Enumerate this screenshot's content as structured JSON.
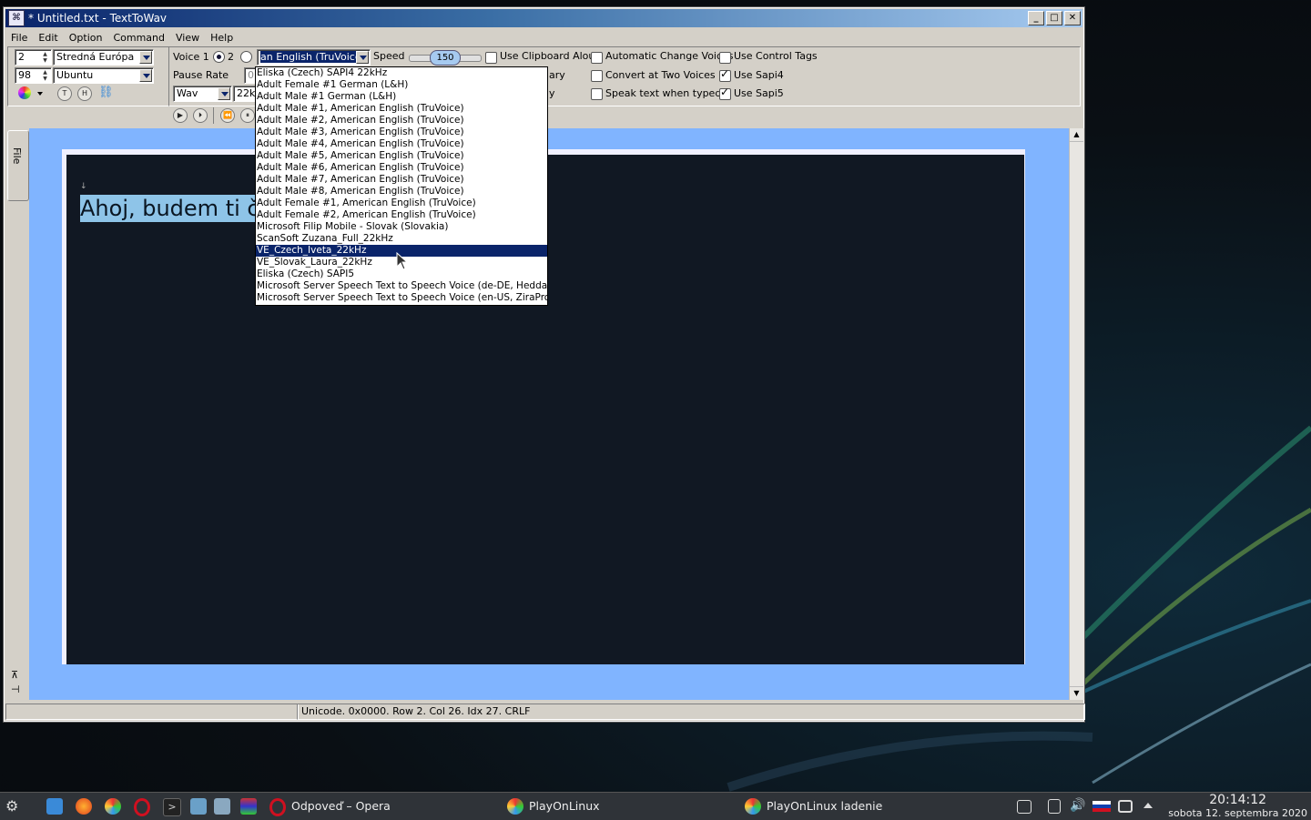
{
  "window": {
    "title": "* Untitled.txt - TextToWav",
    "btn_min": "_",
    "btn_max": "□",
    "btn_close": "✕"
  },
  "menu": [
    "File",
    "Edit",
    "Option",
    "Command",
    "View",
    "Help"
  ],
  "toolbar": {
    "font_size": "2",
    "charset": "Stredná Európa",
    "zoom": "98",
    "font_name": "Ubuntu",
    "voice_label": "Voice 1",
    "voice2_label": "2",
    "voice_selected": "an English (TruVoice)",
    "speed_label": "Speed",
    "speed_value": "150",
    "pause_rate_label": "Pause Rate",
    "pause_rate_value": "0",
    "format_value": "Wav",
    "rate_value": "22k",
    "partial_text_1": "ary",
    "partial_text_2": "y",
    "t_button": "T",
    "h_button": "H"
  },
  "checkboxes": [
    {
      "label": "Use Clipboard Aloud",
      "checked": false
    },
    {
      "label": "Automatic Change Voices",
      "checked": false
    },
    {
      "label": "Use Control Tags",
      "checked": false
    },
    {
      "label": "Convert at Two Voices",
      "checked": false
    },
    {
      "label": "Use Sapi4",
      "checked": true
    },
    {
      "label": "Speak text when typed",
      "checked": false
    },
    {
      "label": "Use Sapi5",
      "checked": true
    }
  ],
  "voices": [
    "Eliska (Czech) SAPI4 22kHz",
    "Adult Female #1 German (L&H)",
    "Adult Male #1 German (L&H)",
    "Adult Male #1, American English (TruVoice)",
    "Adult Male #2, American English (TruVoice)",
    "Adult Male #3, American English (TruVoice)",
    "Adult Male #4, American English (TruVoice)",
    "Adult Male #5, American English (TruVoice)",
    "Adult Male #6, American English (TruVoice)",
    "Adult Male #7, American English (TruVoice)",
    "Adult Male #8, American English (TruVoice)",
    "Adult Female #1, American English (TruVoice)",
    "Adult Female #2, American English (TruVoice)",
    "Microsoft Filip Mobile - Slovak (Slovakia)",
    "ScanSoft Zuzana_Full_22kHz",
    "VE_Czech_Iveta_22kHz",
    "VE_Slovak_Laura_22kHz",
    "Eliska (Czech) SAPI5",
    "Microsoft Server Speech Text to Speech Voice (de-DE, Hedda)",
    "Microsoft Server Speech Text to Speech Voice (en-US, ZiraPro)"
  ],
  "selected_voice_index": 15,
  "side_tab": "File",
  "editor": {
    "text": "Ahoj, budem ti čí",
    "marker": "↓"
  },
  "status": {
    "info": "Unicode. 0x0000. Row 2. Col 26. Idx 27. CRLF"
  },
  "taskbar": {
    "tasks": [
      {
        "label": "Odpoveď – Opera"
      },
      {
        "label": "PlayOnLinux"
      },
      {
        "label": "PlayOnLinux ladenie"
      }
    ],
    "time": "20:14:12",
    "date": "sobota 12. septembra 2020"
  }
}
